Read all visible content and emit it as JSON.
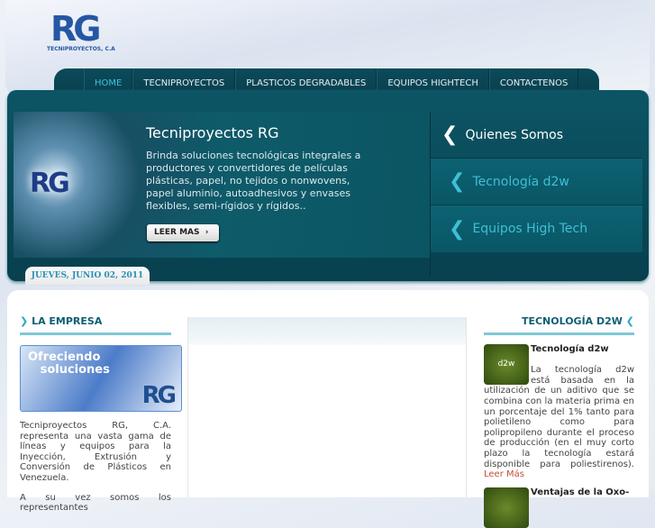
{
  "brand": {
    "logo": "RG",
    "sub": "TECNIPROYECTOS, C.A"
  },
  "nav": [
    {
      "label": "HOME"
    },
    {
      "label": "TECNIPROYECTOS"
    },
    {
      "label": "PLASTICOS DEGRADABLES"
    },
    {
      "label": "EQUIPOS HIGHTECH"
    },
    {
      "label": "CONTACTENOS"
    }
  ],
  "hero": {
    "title": "Tecniproyectos RG",
    "text": "Brinda soluciones tecnológicas integrales a productores y convertidores de películas plásticas, papel, no tejidos o nonwovens, papel aluminio, autoadhesivos y envases flexibles, semi-rígidos y rígidos..",
    "button": "LEER MAS"
  },
  "side_menu": [
    {
      "label": "Quienes Somos"
    },
    {
      "label": "Tecnología d2w"
    },
    {
      "label": "Equipos High Tech"
    }
  ],
  "date": "JUEVES, JUNIO 02, 2011",
  "left": {
    "heading": "LA EMPRESA",
    "promo_line1": "Ofreciendo",
    "promo_line2": "soluciones",
    "p1": "Tecniproyectos RG, C.A. representa una vasta gama de líneas y equipos para la Inyección, Extrusión y Conversión de Plásticos en Venezuela.",
    "p2": "A su vez somos los representantes"
  },
  "right": {
    "heading": "TECNOLOGÍA D2W",
    "item1_title": "Tecnología d2w",
    "item1_text": "La tecnología d2w está basada en la utilización de un aditivo que se combina con la materia prima en un porcentaje del 1% tanto para polietileno como para polipropileno durante el proceso de producción (en el muy corto plazo la tecnología estará disponible para poliestirenos).",
    "item1_link": "Leer Más",
    "item2_title": "Ventajas de la Oxo-",
    "thumb_label": "d2w"
  }
}
